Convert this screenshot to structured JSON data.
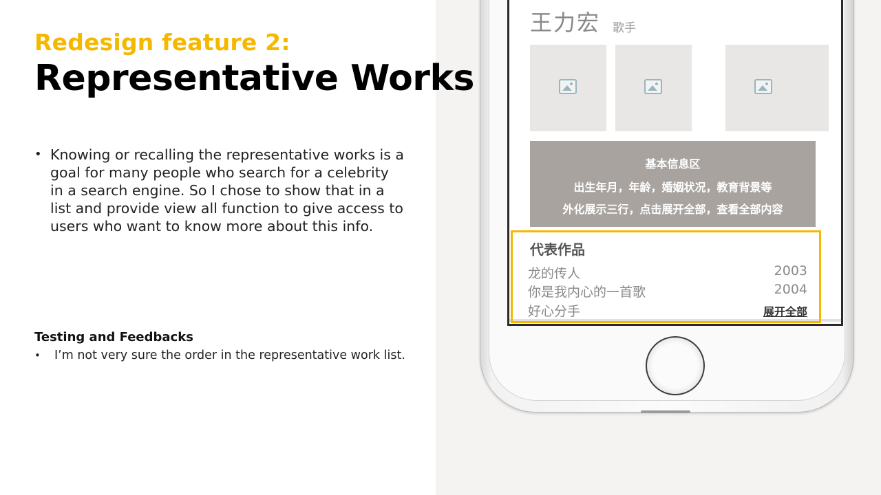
{
  "slide": {
    "subtitle": "Redesign feature 2:",
    "title": "Representative Works",
    "bullets": [
      "Knowing or recalling the representative works is a goal for many people who search for a celebrity in a search engine. So I chose to show that in a list and provide view all function to give access to users who want to know more about this info."
    ],
    "testing": {
      "title": "Testing and Feedbacks",
      "items": [
        "I’m not very sure the order in the representative work list."
      ]
    }
  },
  "phone": {
    "artist_name": "王力宏",
    "artist_role": "歌手",
    "photos": [
      "image-placeholder-icon",
      "image-placeholder-icon",
      "image-placeholder-icon"
    ],
    "info_box": {
      "heading": "基本信息区",
      "line1": "出生年月，年龄，婚姻状况，教育背景等",
      "line2": "外化展示三行，点击展开全部，查看全部内容"
    },
    "works": {
      "title": "代表作品",
      "items": [
        {
          "title": "龙的传人",
          "year": "2003"
        },
        {
          "title": "你是我内心的一首歌",
          "year": "2004"
        },
        {
          "title": "好心分手",
          "year": ""
        }
      ],
      "expand_label": "展开全部"
    }
  },
  "colors": {
    "accent": "#f5b800",
    "info_box": "#a8a39f",
    "right_background": "#f4f3f1"
  }
}
